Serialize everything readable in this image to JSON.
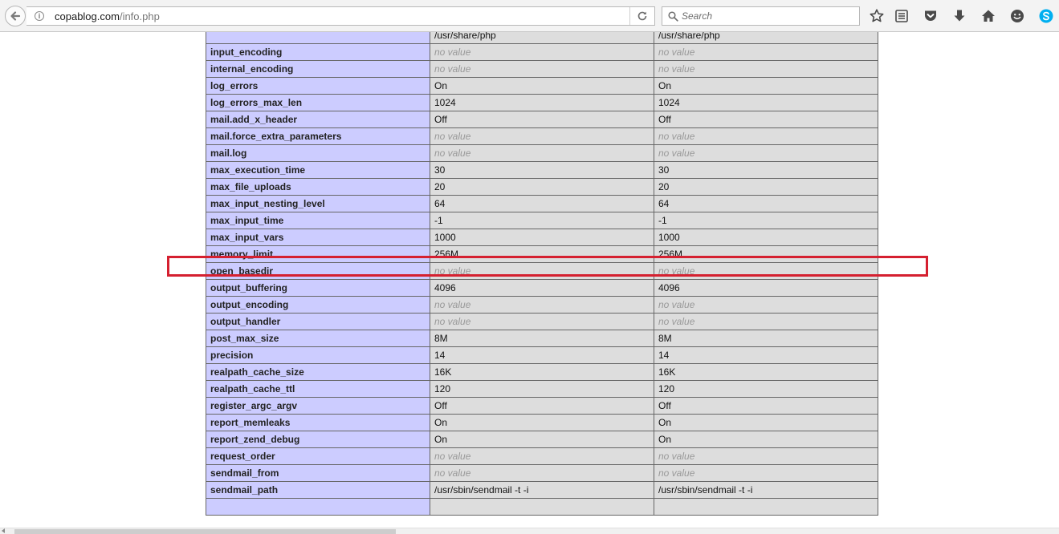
{
  "browser": {
    "url_host": "copablog.com",
    "url_path": "/info.php",
    "search_placeholder": "Search",
    "toolbar_icons": [
      "star-icon",
      "reading-list-icon",
      "pocket-icon",
      "download-icon",
      "home-icon",
      "smiley-icon",
      "skype-icon"
    ]
  },
  "table": {
    "rows": [
      {
        "directive": "",
        "local": "/usr/share/php",
        "master": "/usr/share/php",
        "no_value": false
      },
      {
        "directive": "input_encoding",
        "local": "no value",
        "master": "no value",
        "no_value": true
      },
      {
        "directive": "internal_encoding",
        "local": "no value",
        "master": "no value",
        "no_value": true
      },
      {
        "directive": "log_errors",
        "local": "On",
        "master": "On",
        "no_value": false
      },
      {
        "directive": "log_errors_max_len",
        "local": "1024",
        "master": "1024",
        "no_value": false
      },
      {
        "directive": "mail.add_x_header",
        "local": "Off",
        "master": "Off",
        "no_value": false
      },
      {
        "directive": "mail.force_extra_parameters",
        "local": "no value",
        "master": "no value",
        "no_value": true
      },
      {
        "directive": "mail.log",
        "local": "no value",
        "master": "no value",
        "no_value": true
      },
      {
        "directive": "max_execution_time",
        "local": "30",
        "master": "30",
        "no_value": false
      },
      {
        "directive": "max_file_uploads",
        "local": "20",
        "master": "20",
        "no_value": false
      },
      {
        "directive": "max_input_nesting_level",
        "local": "64",
        "master": "64",
        "no_value": false
      },
      {
        "directive": "max_input_time",
        "local": "-1",
        "master": "-1",
        "no_value": false
      },
      {
        "directive": "max_input_vars",
        "local": "1000",
        "master": "1000",
        "no_value": false
      },
      {
        "directive": "memory_limit",
        "local": "256M",
        "master": "256M",
        "no_value": false,
        "highlighted": true
      },
      {
        "directive": "open_basedir",
        "local": "no value",
        "master": "no value",
        "no_value": true
      },
      {
        "directive": "output_buffering",
        "local": "4096",
        "master": "4096",
        "no_value": false
      },
      {
        "directive": "output_encoding",
        "local": "no value",
        "master": "no value",
        "no_value": true
      },
      {
        "directive": "output_handler",
        "local": "no value",
        "master": "no value",
        "no_value": true
      },
      {
        "directive": "post_max_size",
        "local": "8M",
        "master": "8M",
        "no_value": false
      },
      {
        "directive": "precision",
        "local": "14",
        "master": "14",
        "no_value": false
      },
      {
        "directive": "realpath_cache_size",
        "local": "16K",
        "master": "16K",
        "no_value": false
      },
      {
        "directive": "realpath_cache_ttl",
        "local": "120",
        "master": "120",
        "no_value": false
      },
      {
        "directive": "register_argc_argv",
        "local": "Off",
        "master": "Off",
        "no_value": false
      },
      {
        "directive": "report_memleaks",
        "local": "On",
        "master": "On",
        "no_value": false
      },
      {
        "directive": "report_zend_debug",
        "local": "On",
        "master": "On",
        "no_value": false
      },
      {
        "directive": "request_order",
        "local": "no value",
        "master": "no value",
        "no_value": true
      },
      {
        "directive": "sendmail_from",
        "local": "no value",
        "master": "no value",
        "no_value": true
      },
      {
        "directive": "sendmail_path",
        "local": "/usr/sbin/sendmail -t -i",
        "master": "/usr/sbin/sendmail -t -i",
        "no_value": false
      },
      {
        "directive": "",
        "local": "",
        "master": "",
        "no_value": false
      }
    ]
  },
  "colors": {
    "directive_bg": "#ccccff",
    "value_bg": "#dddddd",
    "no_value_text": "#999999",
    "highlight_border": "#d52030"
  }
}
